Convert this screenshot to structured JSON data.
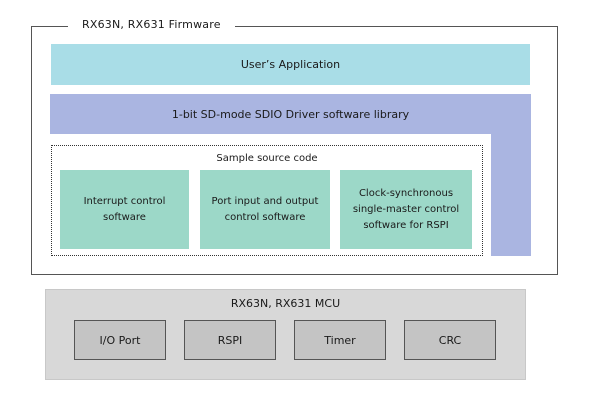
{
  "firmware": {
    "title": "RX63N, RX631 Firmware",
    "app_layer": "User’s Application",
    "driver_layer": "1-bit SD-mode SDIO Driver software library",
    "sample": {
      "title": "Sample source code",
      "modules": [
        "Interrupt control\nsoftware",
        "Port input and output\ncontrol software",
        "Clock-synchronous\nsingle-master control\nsoftware for RSPI"
      ]
    }
  },
  "mcu": {
    "title": "RX63N, RX631 MCU",
    "peripherals": [
      "I/O Port",
      "RSPI",
      "Timer",
      "CRC"
    ]
  },
  "colors": {
    "app_layer": "#a9dde7",
    "driver_layer": "#aab5e1",
    "module": "#9cd8c8",
    "mcu_panel": "#d8d8d8",
    "peripheral": "#c4c4c4"
  }
}
